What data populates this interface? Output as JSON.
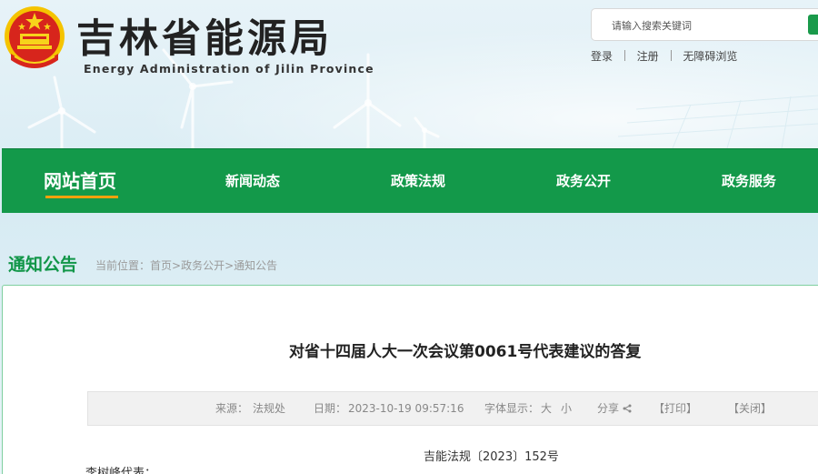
{
  "header": {
    "site_title": "吉林省能源局",
    "site_subtitle": "Energy Administration of Jilin Province",
    "emblem_icon": "national-emblem-icon",
    "search": {
      "placeholder": "请输入搜索关键词",
      "value": ""
    },
    "user_links": {
      "login": "登录",
      "register": "注册",
      "accessibility": "无障碍浏览"
    }
  },
  "nav": {
    "items": [
      "网站首页",
      "新闻动态",
      "政策法规",
      "政务公开",
      "政务服务"
    ],
    "active_index": 0
  },
  "breadcrumb": {
    "section": "通知公告",
    "prefix": "当前位置：",
    "home": "首页",
    "sep1": ">",
    "level2": "政务公开",
    "sep2": ">",
    "level3": "通知公告"
  },
  "article": {
    "title": "对省十四届人大一次会议第0061号代表建议的答复",
    "meta": {
      "source_label": "来源：",
      "source": "法规处",
      "date_label": "日期：",
      "date": "2023-10-19 09:57:16",
      "font_label": "字体显示：",
      "font_large": "大",
      "font_small": "小",
      "share_label": "分享",
      "print": "【打印】",
      "close": "【关闭】"
    },
    "doc_number": "吉能法规〔2023〕152号",
    "salutation": "李树峰代表："
  },
  "colors": {
    "brand_green": "#13994a",
    "accent_orange": "#f1a10c",
    "section_title_green": "#119648",
    "panel_border": "#7fcf9f"
  }
}
